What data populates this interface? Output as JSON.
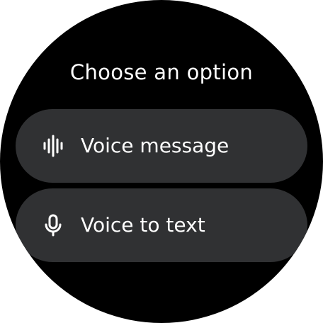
{
  "screen": {
    "title": "Choose an option",
    "background_color": "#000000",
    "chip_color": "#303133",
    "text_color": "#ffffff"
  },
  "options": [
    {
      "label": "Voice message",
      "icon": "audio-waveform-icon"
    },
    {
      "label": "Voice to text",
      "icon": "microphone-icon"
    }
  ]
}
